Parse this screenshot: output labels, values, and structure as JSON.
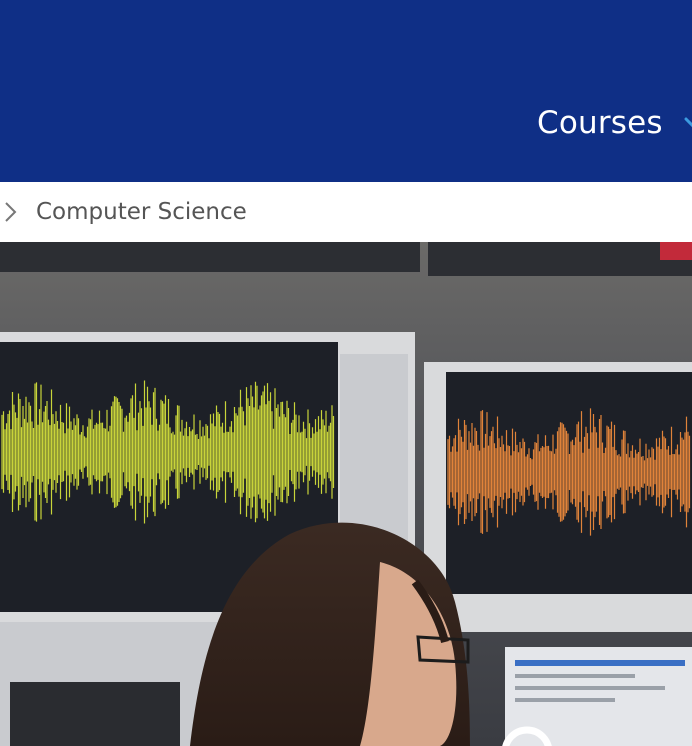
{
  "header": {
    "nav_label": "Courses",
    "background_color": "#0f2f86",
    "chevron_color": "#3b9be0"
  },
  "breadcrumb": {
    "current": "Computer Science"
  },
  "hero": {
    "image": "photo-of-student-in-computer-lab-with-waveform-monitors",
    "left_waveform_color": "#c8d43a",
    "right_waveform_color": "#e0833a"
  }
}
